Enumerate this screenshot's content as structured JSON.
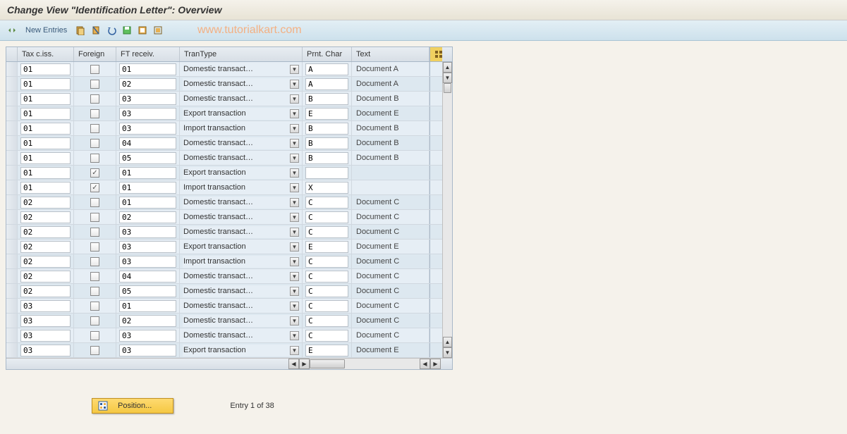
{
  "title": "Change View \"Identification Letter\": Overview",
  "watermark": "www.tutorialkart.com",
  "toolbar": {
    "new_entries": "New Entries"
  },
  "columns": {
    "tax": "Tax c.iss.",
    "foreign": "Foreign",
    "ft": "FT receiv.",
    "trantype": "TranType",
    "prnt": "Prnt. Char",
    "text": "Text"
  },
  "rows": [
    {
      "tax": "01",
      "foreign": false,
      "ft": "01",
      "trantype": "Domestic transact…",
      "prnt": "A",
      "text": "Document A"
    },
    {
      "tax": "01",
      "foreign": false,
      "ft": "02",
      "trantype": "Domestic transact…",
      "prnt": "A",
      "text": "Document A"
    },
    {
      "tax": "01",
      "foreign": false,
      "ft": "03",
      "trantype": "Domestic transact…",
      "prnt": "B",
      "text": "Document B"
    },
    {
      "tax": "01",
      "foreign": false,
      "ft": "03",
      "trantype": "Export transaction",
      "prnt": "E",
      "text": "Document E"
    },
    {
      "tax": "01",
      "foreign": false,
      "ft": "03",
      "trantype": "Import transaction",
      "prnt": "B",
      "text": "Document B"
    },
    {
      "tax": "01",
      "foreign": false,
      "ft": "04",
      "trantype": "Domestic transact…",
      "prnt": "B",
      "text": "Document B"
    },
    {
      "tax": "01",
      "foreign": false,
      "ft": "05",
      "trantype": "Domestic transact…",
      "prnt": "B",
      "text": "Document B"
    },
    {
      "tax": "01",
      "foreign": true,
      "ft": "01",
      "trantype": "Export transaction",
      "prnt": "",
      "text": ""
    },
    {
      "tax": "01",
      "foreign": true,
      "ft": "01",
      "trantype": "Import transaction",
      "prnt": "X",
      "text": ""
    },
    {
      "tax": "02",
      "foreign": false,
      "ft": "01",
      "trantype": "Domestic transact…",
      "prnt": "C",
      "text": "Document C"
    },
    {
      "tax": "02",
      "foreign": false,
      "ft": "02",
      "trantype": "Domestic transact…",
      "prnt": "C",
      "text": "Document C"
    },
    {
      "tax": "02",
      "foreign": false,
      "ft": "03",
      "trantype": "Domestic transact…",
      "prnt": "C",
      "text": "Document C"
    },
    {
      "tax": "02",
      "foreign": false,
      "ft": "03",
      "trantype": "Export transaction",
      "prnt": "E",
      "text": "Document E"
    },
    {
      "tax": "02",
      "foreign": false,
      "ft": "03",
      "trantype": "Import transaction",
      "prnt": "C",
      "text": "Document C"
    },
    {
      "tax": "02",
      "foreign": false,
      "ft": "04",
      "trantype": "Domestic transact…",
      "prnt": "C",
      "text": "Document C"
    },
    {
      "tax": "02",
      "foreign": false,
      "ft": "05",
      "trantype": "Domestic transact…",
      "prnt": "C",
      "text": "Document C"
    },
    {
      "tax": "03",
      "foreign": false,
      "ft": "01",
      "trantype": "Domestic transact…",
      "prnt": "C",
      "text": "Document C"
    },
    {
      "tax": "03",
      "foreign": false,
      "ft": "02",
      "trantype": "Domestic transact…",
      "prnt": "C",
      "text": "Document C"
    },
    {
      "tax": "03",
      "foreign": false,
      "ft": "03",
      "trantype": "Domestic transact…",
      "prnt": "C",
      "text": "Document C"
    },
    {
      "tax": "03",
      "foreign": false,
      "ft": "03",
      "trantype": "Export transaction",
      "prnt": "E",
      "text": "Document E"
    }
  ],
  "footer": {
    "position_label": "Position...",
    "entry_label": "Entry 1 of 38"
  }
}
